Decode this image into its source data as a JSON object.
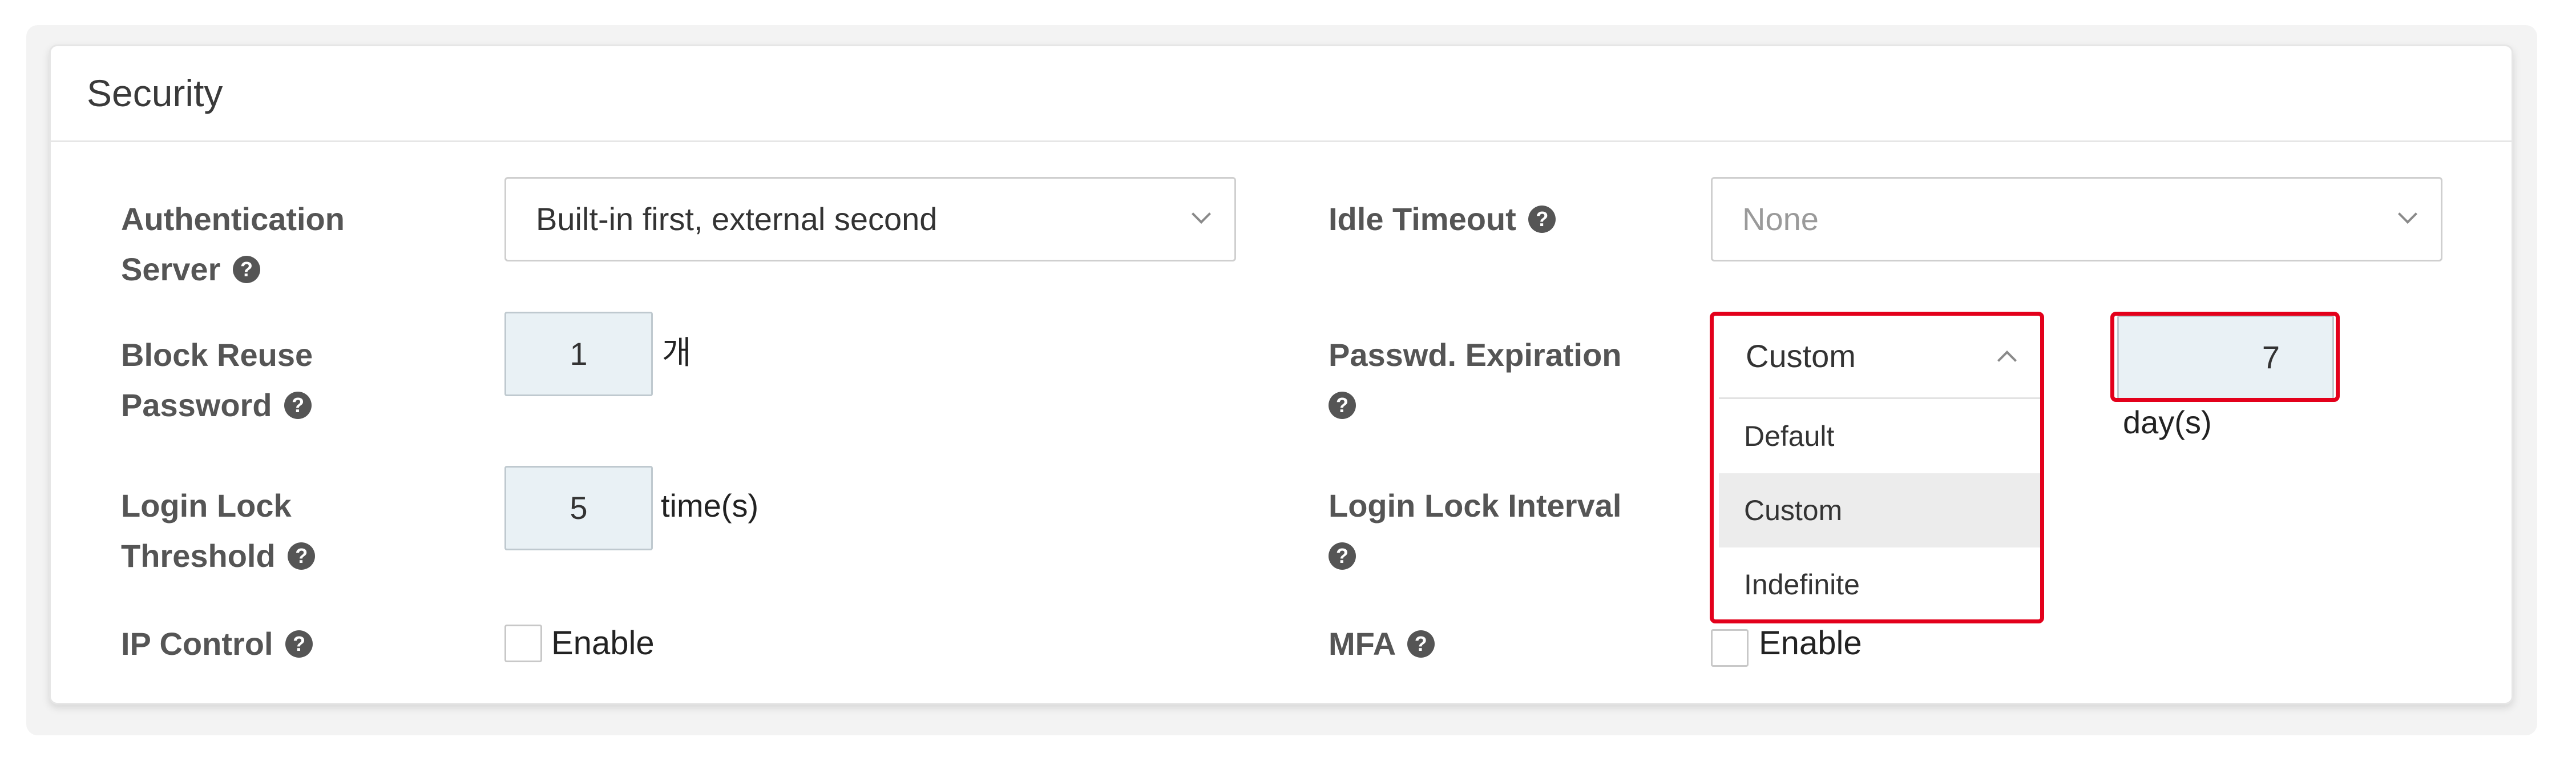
{
  "section": {
    "title": "Security"
  },
  "fields": {
    "auth_server": {
      "label_line1": "Authentication",
      "label_line2": "Server",
      "value": "Built-in first, external second"
    },
    "idle_timeout": {
      "label": "Idle Timeout",
      "value": "None"
    },
    "block_reuse": {
      "label_line1": "Block Reuse",
      "label_line2": "Password",
      "value": "1",
      "unit": "개"
    },
    "passwd_expiration": {
      "label_line1": "Passwd. Expiration",
      "selected": "Custom",
      "days_value": "7",
      "days_unit": "day(s)",
      "options": [
        "Default",
        "Custom",
        "Indefinite"
      ]
    },
    "login_lock_threshold": {
      "label_line1": "Login Lock",
      "label_line2": "Threshold",
      "value": "5",
      "unit": "time(s)"
    },
    "login_lock_interval": {
      "label_line1": "Login Lock Interval"
    },
    "ip_control": {
      "label": "IP Control",
      "checkbox_label": "Enable",
      "checked": false
    },
    "mfa": {
      "label": "MFA",
      "checkbox_label": "Enable",
      "checked": false
    }
  },
  "icons": {
    "help": "question-circle-icon",
    "dropdown": "chevron-icon"
  },
  "help_glyph": "?",
  "colors": {
    "highlight": "#e3001b",
    "input_fill": "#e9f1f5",
    "active_option": "#ececec"
  }
}
